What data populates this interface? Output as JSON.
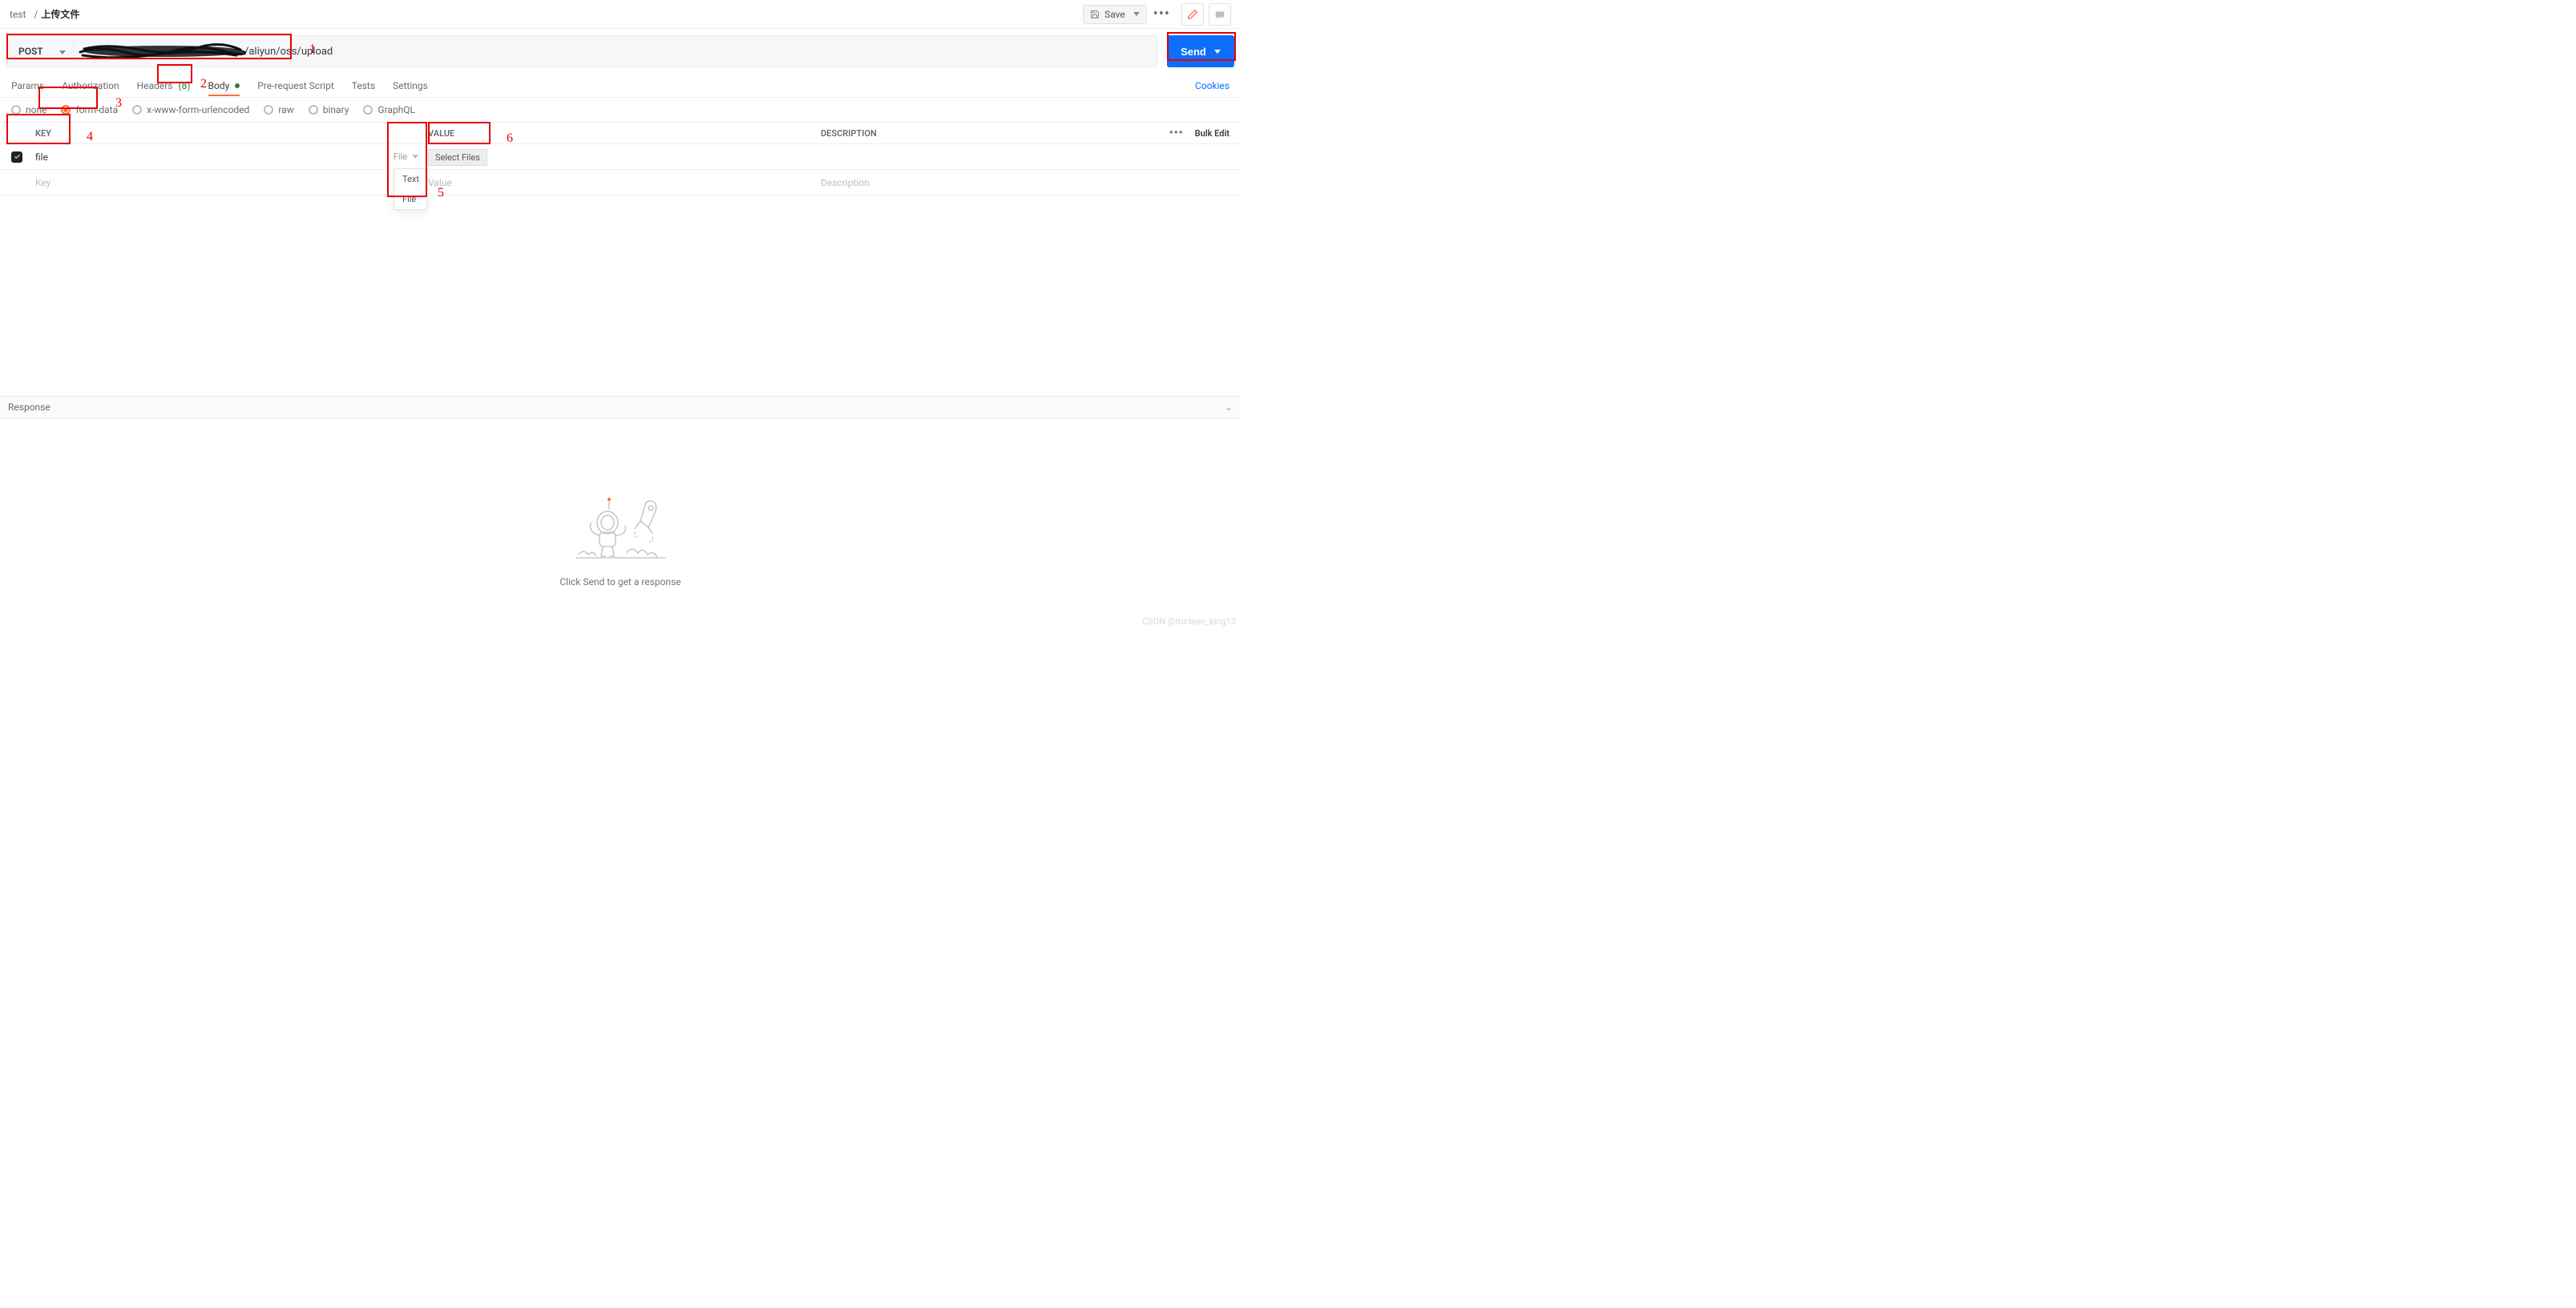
{
  "breadcrumb": {
    "folder": "test",
    "name": "上传文件"
  },
  "toolbar": {
    "save": "Save"
  },
  "request": {
    "method": "POST",
    "url_suffix": "/aliyun/oss/upload",
    "send": "Send"
  },
  "tabs": {
    "params": "Params",
    "auth": "Authorization",
    "headers_label": "Headers",
    "headers_count": "(8)",
    "body": "Body",
    "pre": "Pre-request Script",
    "tests": "Tests",
    "settings": "Settings",
    "cookies": "Cookies"
  },
  "body_types": {
    "none": "none",
    "formdata": "form-data",
    "xwww": "x-www-form-urlencoded",
    "raw": "raw",
    "binary": "binary",
    "graphql": "GraphQL"
  },
  "fd_header": {
    "key": "KEY",
    "value": "VALUE",
    "desc": "DESCRIPTION",
    "bulk": "Bulk Edit"
  },
  "fd_rows": {
    "row0": {
      "key": "file",
      "type": "File",
      "value_btn": "Select Files"
    },
    "row1": {
      "key_placeholder": "Key",
      "value_placeholder": "Value",
      "desc_placeholder": "Description"
    }
  },
  "type_popover": {
    "text": "Text",
    "file": "File"
  },
  "response": {
    "title": "Response",
    "empty": "Click Send to get a response"
  },
  "annotations": {
    "n1": "1",
    "n2": "2",
    "n3": "3",
    "n4": "4",
    "n5": "5",
    "n6": "6"
  },
  "watermark": "CSDN @thirteen_king13"
}
